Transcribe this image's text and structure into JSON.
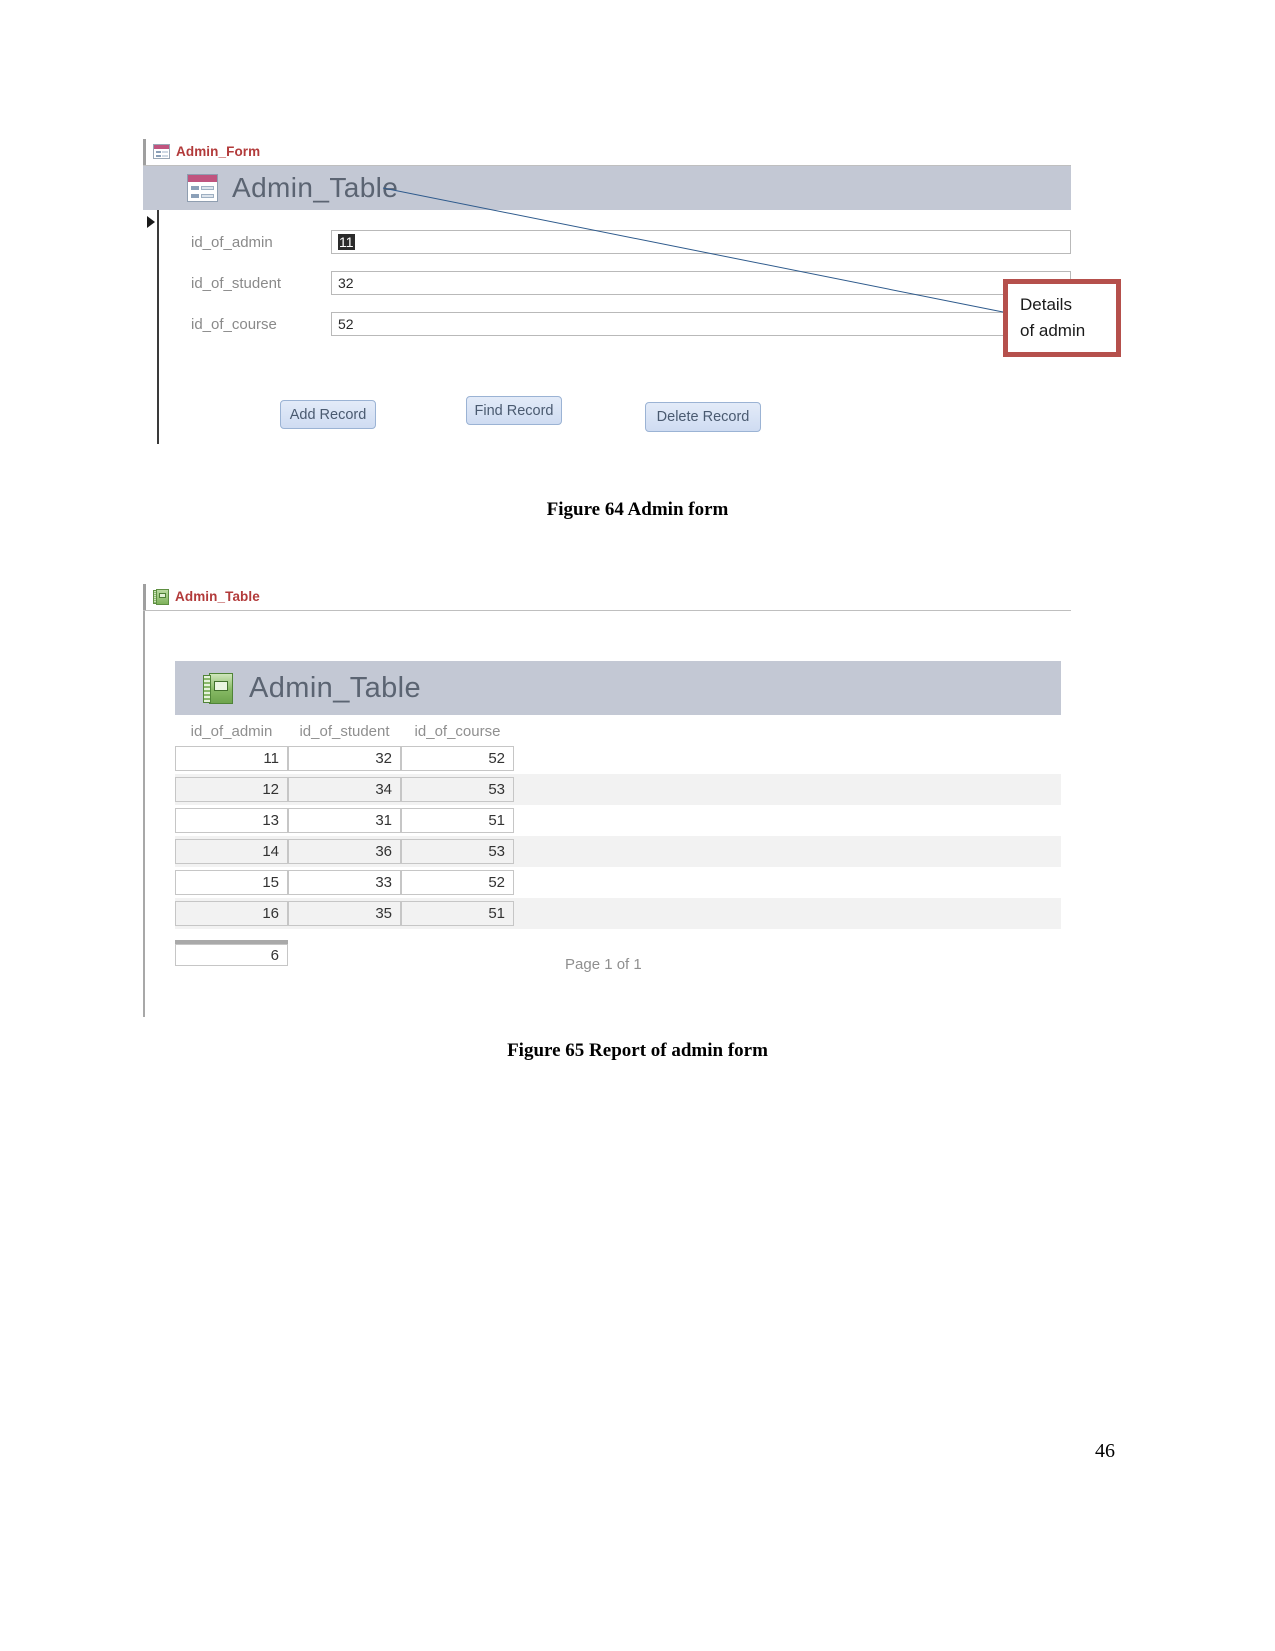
{
  "document": {
    "page_number": "46"
  },
  "figure64": {
    "caption": "Figure 64 Admin form",
    "tab": {
      "label": "Admin_Form",
      "icon": "form-icon"
    },
    "banner": {
      "title": "Admin_Table",
      "icon": "form-icon-large"
    },
    "fields": [
      {
        "label": "id_of_admin",
        "value": "11",
        "selected": true
      },
      {
        "label": "id_of_student",
        "value": "32",
        "selected": false
      },
      {
        "label": "id_of_course",
        "value": "52",
        "selected": false
      }
    ],
    "buttons": [
      {
        "label": "Add Record"
      },
      {
        "label": "Find Record"
      },
      {
        "label": "Delete Record"
      }
    ],
    "callout": {
      "line1": "Details",
      "line2": "of admin",
      "border_color": "#b5504c"
    }
  },
  "figure65": {
    "caption": "Figure 65 Report of admin form",
    "tab": {
      "label": "Admin_Table",
      "icon": "report-icon"
    },
    "banner": {
      "title": "Admin_Table",
      "icon": "report-icon-large"
    },
    "table": {
      "columns": [
        "id_of_admin",
        "id_of_student",
        "id_of_course"
      ],
      "rows": [
        [
          "11",
          "32",
          "52"
        ],
        [
          "12",
          "34",
          "53"
        ],
        [
          "13",
          "31",
          "51"
        ],
        [
          "14",
          "36",
          "53"
        ],
        [
          "15",
          "33",
          "52"
        ],
        [
          "16",
          "35",
          "51"
        ]
      ],
      "record_count": "6"
    },
    "footer": {
      "page_of": "Page 1 of 1"
    }
  }
}
